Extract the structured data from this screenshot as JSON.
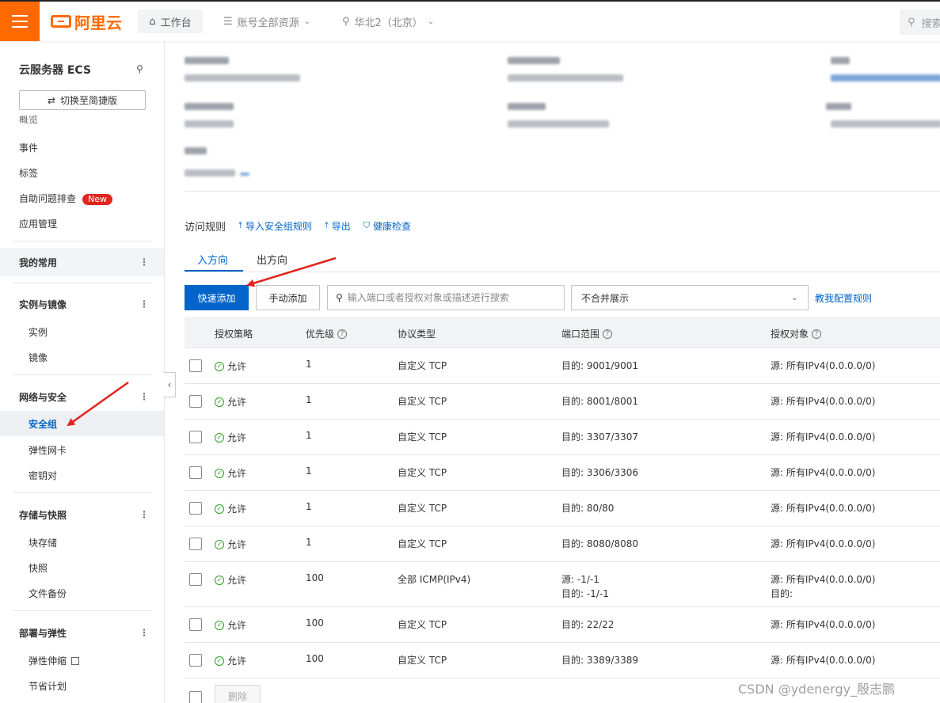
{
  "topbar": {
    "logo_text": "阿里云",
    "workbench_label": "工作台",
    "resources_label": "账号全部资源",
    "region_label": "华北2（北京）",
    "search_placeholder": "搜索"
  },
  "sidebar": {
    "title": "云服务器 ECS",
    "switch_label": "切换至简捷版",
    "cut_item": "概览",
    "items_top": [
      "事件",
      "标签",
      "自助问题排查",
      "应用管理"
    ],
    "new_badge": "New",
    "favorites_label": "我的常用",
    "groups": [
      {
        "label": "实例与镜像",
        "items": [
          "实例",
          "镜像"
        ]
      },
      {
        "label": "网络与安全",
        "items": [
          "安全组",
          "弹性网卡",
          "密钥对"
        ]
      },
      {
        "label": "存储与快照",
        "items": [
          "块存储",
          "快照",
          "文件备份"
        ]
      },
      {
        "label": "部署与弹性",
        "items": [
          "弹性伸缩",
          "节省计划"
        ]
      }
    ]
  },
  "rules": {
    "title": "访问规则",
    "import_label": "导入安全组规则",
    "export_label": "导出",
    "health_label": "健康检查"
  },
  "tabs": {
    "inbound": "入方向",
    "outbound": "出方向"
  },
  "toolbar": {
    "quick_add": "快速添加",
    "manual_add": "手动添加",
    "search_placeholder": "输入端口或者授权对象或描述进行搜索",
    "merge_select": "不合并展示",
    "help_link": "教我配置规则"
  },
  "table": {
    "headers": {
      "policy": "授权策略",
      "priority": "优先级",
      "protocol": "协议类型",
      "port": "端口范围",
      "object": "授权对象"
    },
    "rows": [
      {
        "policy": "允许",
        "priority": "1",
        "protocol": "自定义 TCP",
        "port": [
          "目的: 9001/9001"
        ],
        "object": [
          "源: 所有IPv4(0.0.0.0/0)"
        ]
      },
      {
        "policy": "允许",
        "priority": "1",
        "protocol": "自定义 TCP",
        "port": [
          "目的: 8001/8001"
        ],
        "object": [
          "源: 所有IPv4(0.0.0.0/0)"
        ]
      },
      {
        "policy": "允许",
        "priority": "1",
        "protocol": "自定义 TCP",
        "port": [
          "目的: 3307/3307"
        ],
        "object": [
          "源: 所有IPv4(0.0.0.0/0)"
        ]
      },
      {
        "policy": "允许",
        "priority": "1",
        "protocol": "自定义 TCP",
        "port": [
          "目的: 3306/3306"
        ],
        "object": [
          "源: 所有IPv4(0.0.0.0/0)"
        ]
      },
      {
        "policy": "允许",
        "priority": "1",
        "protocol": "自定义 TCP",
        "port": [
          "目的: 80/80"
        ],
        "object": [
          "源: 所有IPv4(0.0.0.0/0)"
        ]
      },
      {
        "policy": "允许",
        "priority": "1",
        "protocol": "自定义 TCP",
        "port": [
          "目的: 8080/8080"
        ],
        "object": [
          "源: 所有IPv4(0.0.0.0/0)"
        ]
      },
      {
        "policy": "允许",
        "priority": "100",
        "protocol": "全部 ICMP(IPv4)",
        "port": [
          "源: -1/-1",
          "目的: -1/-1"
        ],
        "object": [
          "源: 所有IPv4(0.0.0.0/0)",
          "目的:"
        ]
      },
      {
        "policy": "允许",
        "priority": "100",
        "protocol": "自定义 TCP",
        "port": [
          "目的: 22/22"
        ],
        "object": [
          "源: 所有IPv4(0.0.0.0/0)"
        ]
      },
      {
        "policy": "允许",
        "priority": "100",
        "protocol": "自定义 TCP",
        "port": [
          "目的: 3389/3389"
        ],
        "object": [
          "源: 所有IPv4(0.0.0.0/0)"
        ]
      }
    ],
    "delete_label": "删除"
  },
  "watermark": "CSDN @ydenergy_殷志鹏",
  "colors": {
    "brand": "#ff6a00",
    "primary": "#0064c8",
    "success": "#2ea121",
    "annotation": "#e1251b"
  }
}
